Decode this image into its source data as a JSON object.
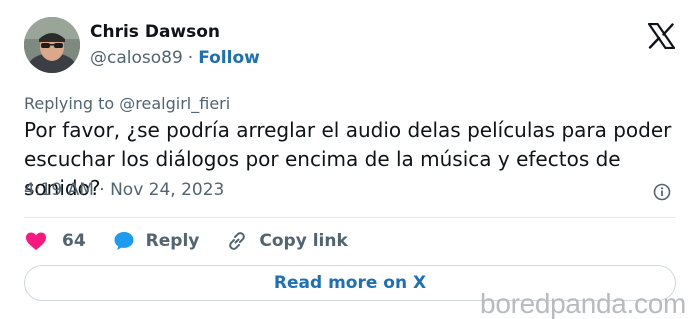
{
  "author": {
    "name": "Chris Dawson",
    "handle": "@caloso89",
    "separator": "·",
    "follow_label": "Follow"
  },
  "icons": {
    "brand": "x-logo-icon",
    "info": "info-icon",
    "like": "heart-icon",
    "reply": "speech-bubble-icon",
    "copy": "link-icon"
  },
  "reply_context": {
    "prefix": "Replying to",
    "mention": "@realgirl_fieri"
  },
  "tweet": {
    "text": "Por favor, ¿se podría arreglar el audio delas películas para poder escuchar los diálogos por encima de la música y efectos de sonido?",
    "timestamp": "4:19 AM · Nov 24, 2023"
  },
  "actions": {
    "like_count": "64",
    "reply_label": "Reply",
    "copy_label": "Copy link"
  },
  "read_more_label": "Read more on X",
  "watermark": "boredpanda.com",
  "colors": {
    "link": "#1d6fb8",
    "like": "#f91880",
    "reply": "#1d9bf0",
    "muted": "#536471",
    "text": "#0f1419",
    "border": "#cfd9de"
  }
}
